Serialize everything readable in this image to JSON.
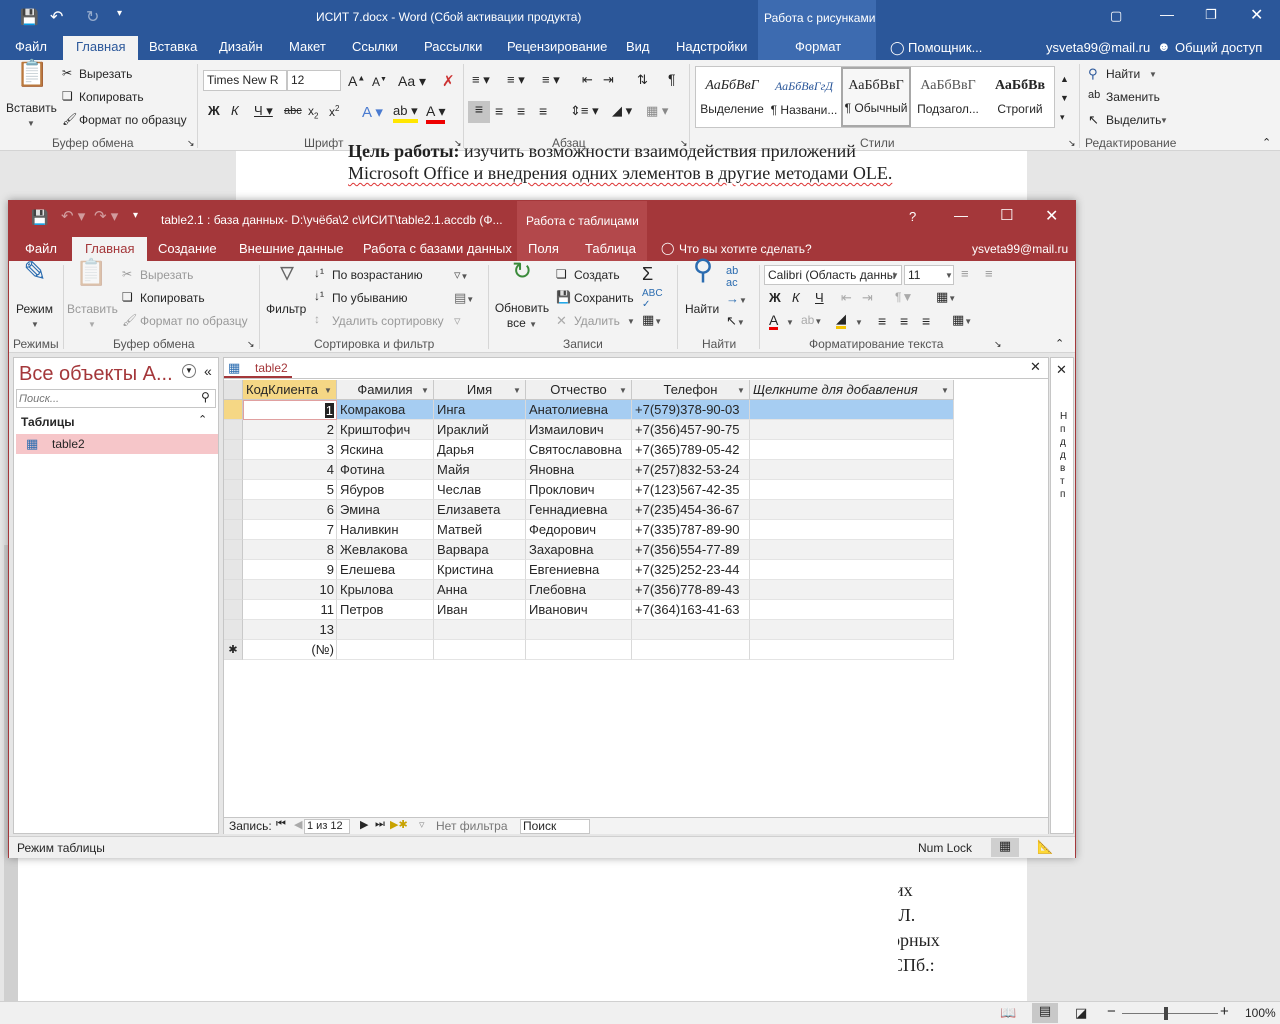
{
  "word": {
    "title": "ИСИТ 7.docx - Word (Сбой активации продукта)",
    "context_tab": "Работа с рисунками",
    "tabs": [
      "Файл",
      "Главная",
      "Вставка",
      "Дизайн",
      "Макет",
      "Ссылки",
      "Рассылки",
      "Рецензирование",
      "Вид",
      "Надстройки",
      "Формат"
    ],
    "tell_me": "Помощник...",
    "user": "ysveta99@mail.ru",
    "share": "Общий доступ",
    "clipboard": {
      "paste": "Вставить",
      "cut": "Вырезать",
      "copy": "Копировать",
      "format_painter": "Формат по образцу",
      "label": "Буфер обмена"
    },
    "font": {
      "name": "Times New R",
      "size": "12",
      "label": "Шрифт"
    },
    "paragraph_label": "Абзац",
    "styles": {
      "label": "Стили",
      "items": [
        {
          "preview": "АаБбВвГ",
          "name": "Выделение"
        },
        {
          "preview": "АаБбВвГгД",
          "name": "¶ Названи..."
        },
        {
          "preview": "АаБбВвГ",
          "name": "¶ Обычный"
        },
        {
          "preview": "АаБбВвГ",
          "name": "Подзагол..."
        },
        {
          "preview": "АаБбВв",
          "name": "Строгий"
        }
      ]
    },
    "editing": {
      "find": "Найти",
      "replace": "Заменить",
      "select": "Выделить",
      "label": "Редактирование"
    },
    "doc_line1_bold": "Цель работы:",
    "doc_line1_rest": " изучить возможности взаимодействия приложений",
    "doc_line2": "Microsoft Office и внедрения одних элементов в другие методами OLE.",
    "doc_frag1": "их",
    "doc_frag2": ".Л.",
    "doc_frag3": "орных",
    "doc_frag4": "СПб.:",
    "zoom": "100%"
  },
  "access": {
    "title": "table2.1 : база данных- D:\\учёба\\2 с\\ИСИТ\\table2.1.accdb (Ф...",
    "context_tab": "Работа с таблицами",
    "help": "?",
    "tabs": [
      "Файл",
      "Главная",
      "Создание",
      "Внешние данные",
      "Работа с базами данных",
      "Поля",
      "Таблица"
    ],
    "tell_me": "Что вы хотите сделать?",
    "user": "ysveta99@mail.ru",
    "ribbon": {
      "mode": "Режим",
      "paste": "Вставить",
      "cut": "Вырезать",
      "copy": "Копировать",
      "format_painter": "Формат по образцу",
      "filter": "Фильтр",
      "asc": "По возрастанию",
      "desc": "По убыванию",
      "remove_sort": "Удалить сортировку",
      "refresh": "Обновить все",
      "refresh1": "Обновить",
      "refresh2": "все",
      "new": "Создать",
      "save": "Сохранить",
      "delete": "Удалить",
      "find": "Найти",
      "font_name": "Calibri (Область данны",
      "font_size": "11",
      "groups": {
        "views": "Режимы",
        "clipboard": "Буфер обмена",
        "sort_filter": "Сортировка и фильтр",
        "records": "Записи",
        "find": "Найти",
        "text_format": "Форматирование текста"
      }
    },
    "nav": {
      "title": "Все объекты A...",
      "search_placeholder": "Поиск...",
      "section": "Таблицы",
      "item": "table2"
    },
    "doc_tab": "table2",
    "columns": [
      "КодКлиента",
      "Фамилия",
      "Имя",
      "Отчество",
      "Телефон",
      "Щелкните для добавления"
    ],
    "rows": [
      [
        "1",
        "Комракова",
        "Инга",
        "Анатолиевна",
        "+7(579)378-90-03"
      ],
      [
        "2",
        "Криштофич",
        "Ираклий",
        "Измаилович",
        "+7(356)457-90-75"
      ],
      [
        "3",
        "Яскина",
        "Дарья",
        "Святославовна",
        "+7(365)789-05-42"
      ],
      [
        "4",
        "Фотина",
        "Майя",
        "Яновна",
        "+7(257)832-53-24"
      ],
      [
        "5",
        "Ябуров",
        "Чеслав",
        "Проклович",
        "+7(123)567-42-35"
      ],
      [
        "6",
        "Эмина",
        "Елизавета",
        "Геннадиевна",
        "+7(235)454-36-67"
      ],
      [
        "7",
        "Наливкин",
        "Матвей",
        "Федорович",
        "+7(335)787-89-90"
      ],
      [
        "8",
        "Жевлакова",
        "Варвара",
        "Захаровна",
        "+7(356)554-77-89"
      ],
      [
        "9",
        "Елешева",
        "Кристина",
        "Евгениевна",
        "+7(325)252-23-44"
      ],
      [
        "10",
        "Крылова",
        "Анна",
        "Глебовна",
        "+7(356)778-89-43"
      ],
      [
        "11",
        "Петров",
        "Иван",
        "Иванович",
        "+7(364)163-41-63"
      ],
      [
        "13",
        "",
        "",
        "",
        ""
      ],
      [
        "(№)",
        "",
        "",
        "",
        ""
      ]
    ],
    "new_row_marker": "✱",
    "record_nav": {
      "label": "Запись:",
      "position": "1 из 12",
      "filter": "Нет фильтра",
      "search": "Поиск"
    },
    "side_letters": "Н\nп\nд\nд\nв\nт\nп",
    "status": "Режим таблицы",
    "numlock": "Num Lock"
  },
  "colors": {
    "word_blue": "#2b579a",
    "access_red": "#a4373a",
    "selected_row": "#a6cdf2",
    "nav_selected": "#f6c6c9"
  }
}
